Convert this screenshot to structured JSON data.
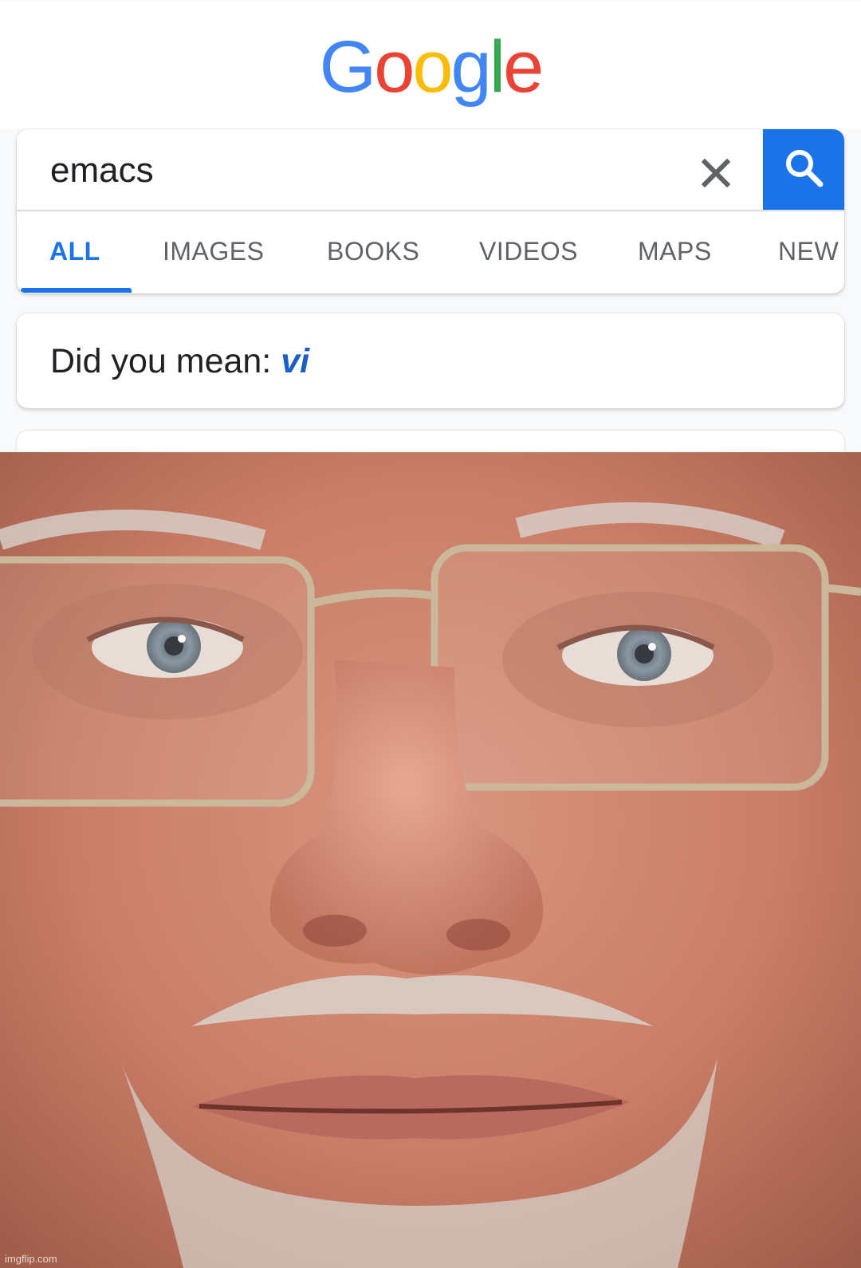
{
  "logo": {
    "letters": [
      "G",
      "o",
      "o",
      "g",
      "l",
      "e"
    ],
    "colors": [
      "#4285f4",
      "#ea4335",
      "#fbbc05",
      "#4285f4",
      "#34a853",
      "#ea4335"
    ]
  },
  "search": {
    "query": "emacs",
    "clear_icon": "close-icon",
    "search_icon": "search-icon",
    "button_color": "#1a73e8"
  },
  "tabs": [
    {
      "label": "ALL",
      "active": true
    },
    {
      "label": "IMAGES",
      "active": false
    },
    {
      "label": "BOOKS",
      "active": false
    },
    {
      "label": "VIDEOS",
      "active": false
    },
    {
      "label": "MAPS",
      "active": false
    },
    {
      "label": "NEW",
      "active": false
    }
  ],
  "did_you_mean": {
    "prefix": "Did you mean:",
    "suggestion": "vi"
  },
  "photo": {
    "description_icon": "face-photo"
  },
  "watermark": "imgflip.com"
}
